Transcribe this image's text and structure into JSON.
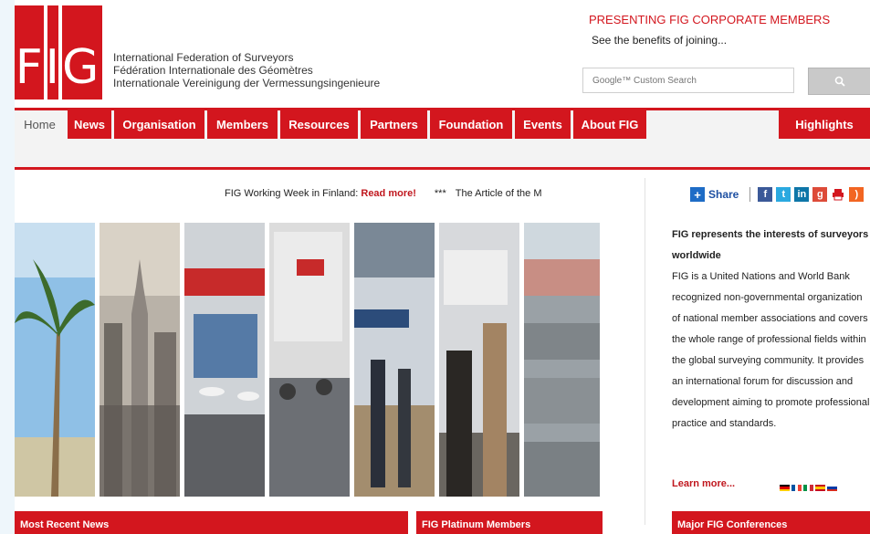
{
  "logo": {
    "text": "FIG"
  },
  "org_names": [
    "International Federation of Surveyors",
    "Fédération Internationale des Géomètres",
    "Internationale Vereinigung der Vermessungsingenieure"
  ],
  "corporate": {
    "title": "PRESENTING FIG CORPORATE MEMBERS",
    "subtitle": "See the benefits of joining..."
  },
  "search": {
    "placeholder": "Google™ Custom Search",
    "button_icon": "search-icon"
  },
  "nav": {
    "items": [
      "Home",
      "News",
      "Organisation",
      "Members",
      "Resources",
      "Partners",
      "Foundation",
      "Events",
      "About FIG"
    ],
    "highlights": "Highlights"
  },
  "ticker": {
    "text": "FIG Working Week in Finland: ",
    "link": "Read more!",
    "separator": "***",
    "next": "The Article of the M"
  },
  "share": {
    "label": "Share"
  },
  "about": {
    "heading": "FIG represents the interests of surveyors worldwide",
    "body": "FIG is a United Nations and World Bank recognized non-governmental organization of national member associations and covers the whole range of professional fields within the global surveying community. It provides an international forum for discussion and development aiming to promote professional practice and standards.",
    "learn_more": "Learn more..."
  },
  "sections": {
    "recent_news": "Most Recent News",
    "platinum": "FIG Platinum Members",
    "conferences": "Major FIG Conferences"
  },
  "colors": {
    "brand_red": "#d3161e",
    "link_red": "#c0171e",
    "share_blue": "#1e50a2"
  }
}
